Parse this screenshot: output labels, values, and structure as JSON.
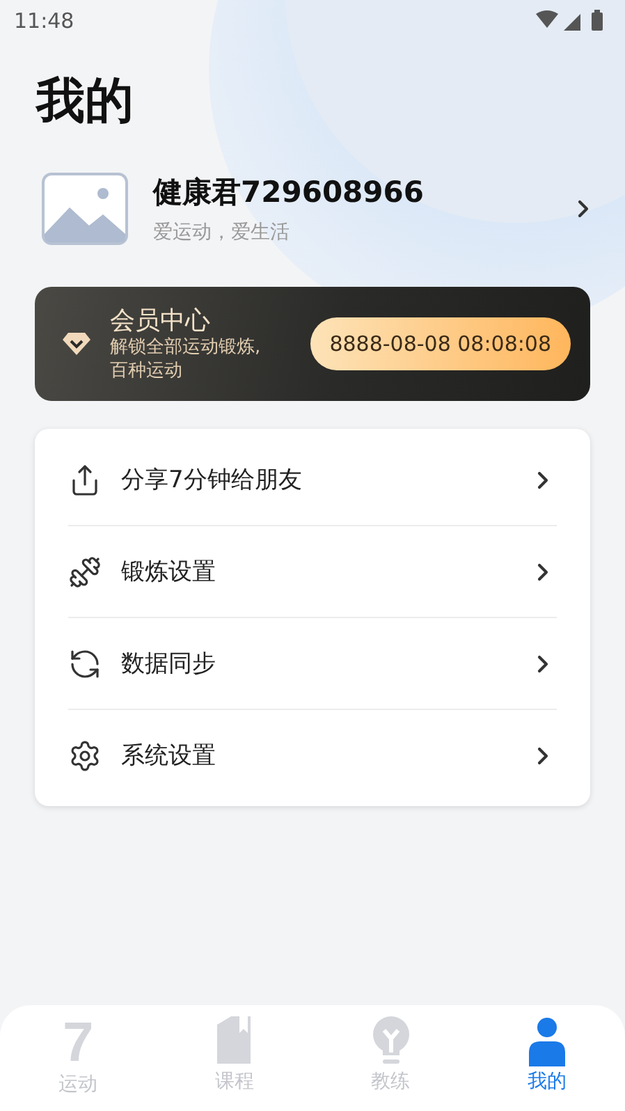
{
  "status_bar": {
    "time": "11:48"
  },
  "title": "我的",
  "profile": {
    "name": "健康君729608966",
    "motto": "爱运动，爱生活"
  },
  "membership": {
    "title": "会员中心",
    "description": "解锁全部运动锻炼,百种运动",
    "expiry": "8888-08-08 08:08:08"
  },
  "menu": [
    {
      "kind": "share",
      "label": "分享7分钟给朋友"
    },
    {
      "kind": "dumbbell",
      "label": "锻炼设置"
    },
    {
      "kind": "sync",
      "label": "数据同步"
    },
    {
      "kind": "settings",
      "label": "系统设置"
    }
  ],
  "tabs": [
    {
      "kind": "glyph",
      "glyph": "7",
      "label": "运动",
      "selected": false
    },
    {
      "kind": "book",
      "label": "课程",
      "selected": false
    },
    {
      "kind": "bulb",
      "label": "教练",
      "selected": false
    },
    {
      "kind": "person",
      "label": "我的",
      "selected": true
    }
  ]
}
